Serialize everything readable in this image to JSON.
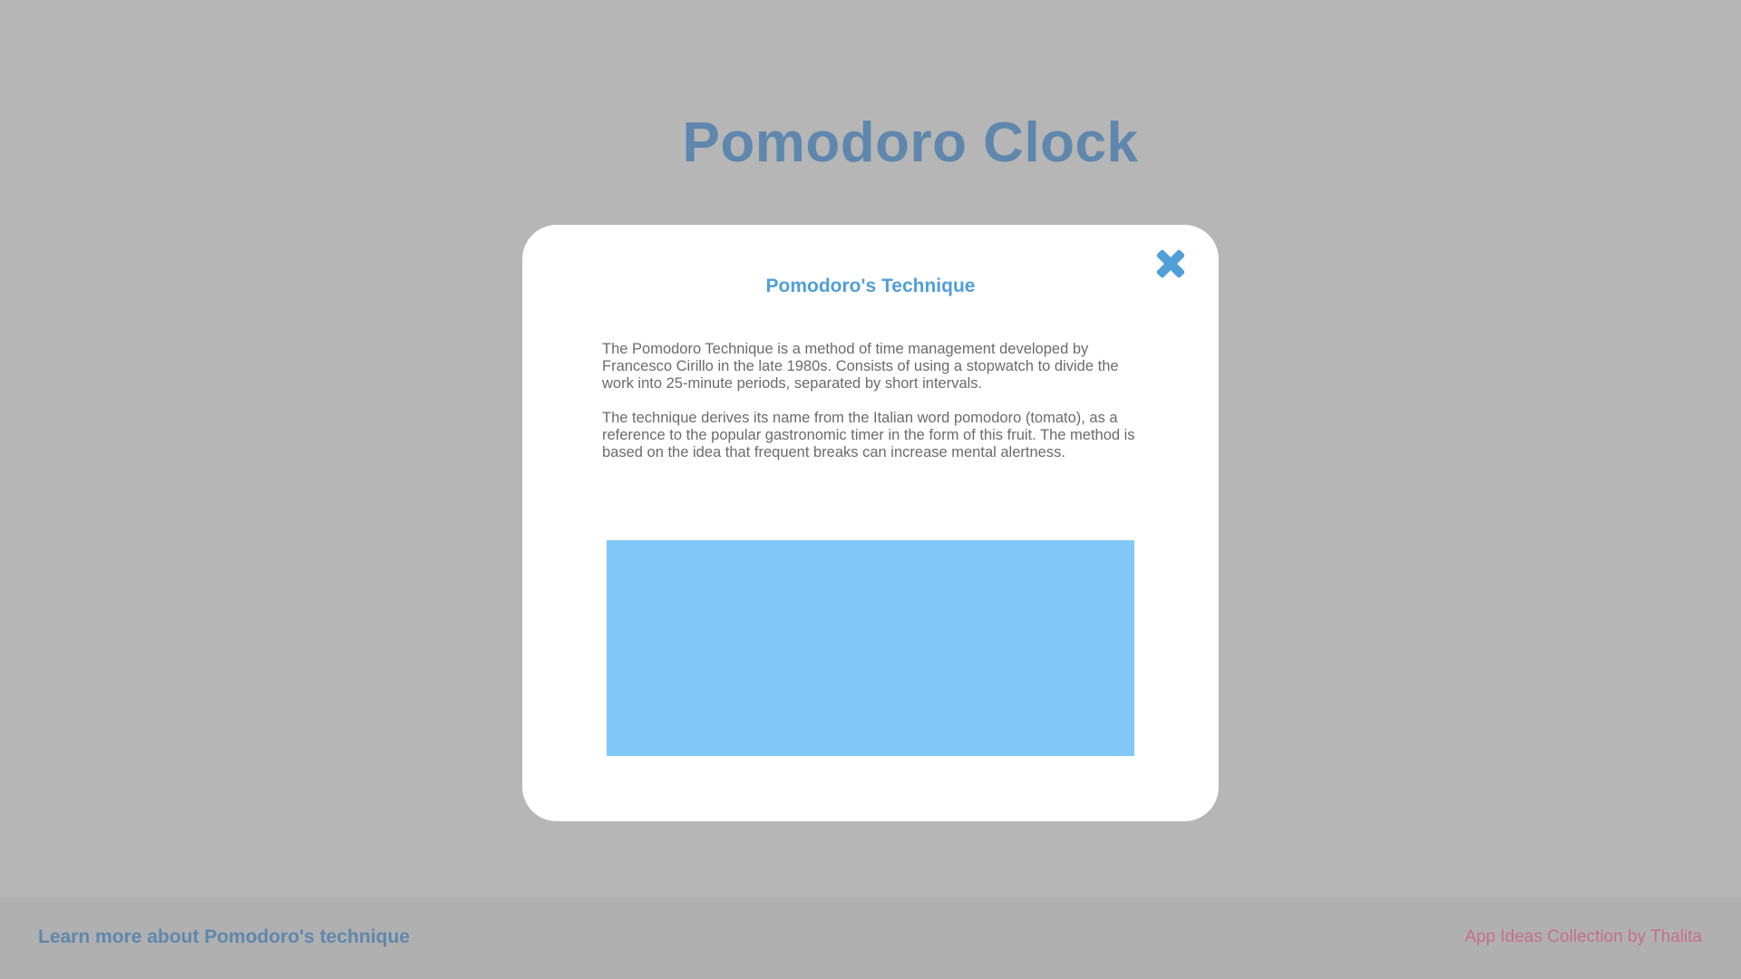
{
  "header": {
    "title": "Pomodoro Clock"
  },
  "modal": {
    "title": "Pomodoro's Technique",
    "close_icon": "close-icon",
    "paragraphs": [
      "The Pomodoro Technique is a method of time management developed by Francesco Cirillo in the late 1980s. Consists of using a stopwatch to divide the work into 25-minute periods, separated by short intervals.",
      "The technique derives its name from the Italian word pomodoro (tomato), as a reference to the popular gastronomic timer in the form of this fruit. The method is based on the idea that frequent breaks can increase mental alertness."
    ]
  },
  "footer": {
    "link_label": "Learn more about Pomodoro's technique",
    "credit": "App Ideas Collection by Thalita"
  },
  "colors": {
    "backdrop": "#b6b6b6",
    "title": "#5f87ad",
    "modal_accent": "#4f9fd9",
    "media_placeholder": "#81c7f7",
    "credit": "#c56f8b"
  }
}
